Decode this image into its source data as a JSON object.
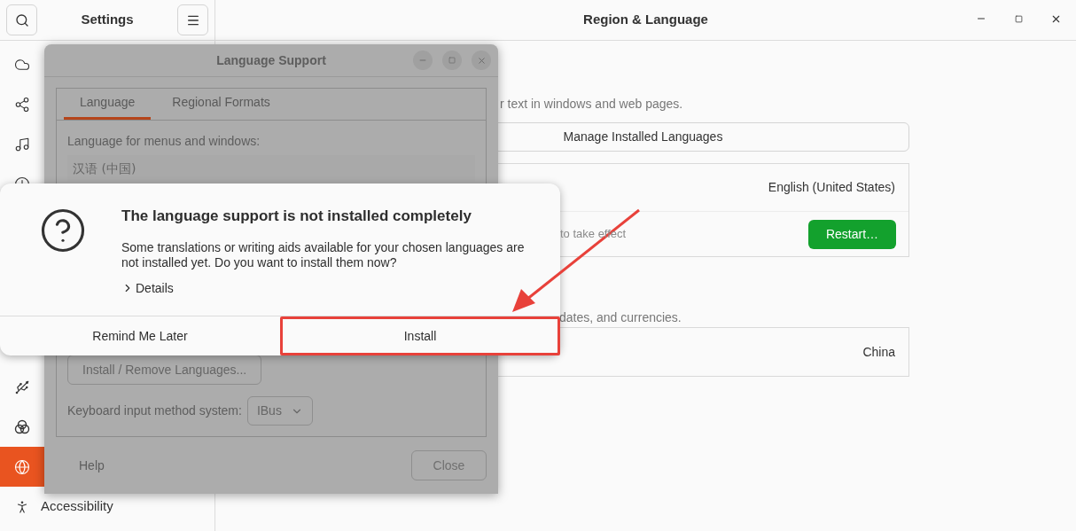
{
  "settings_window": {
    "sidebar_title": "Settings",
    "page_title": "Region & Language",
    "sidebar": {
      "items_top": [
        {
          "kind": "cloud",
          "selected": false
        },
        {
          "kind": "share",
          "selected": false
        },
        {
          "kind": "music",
          "selected": false
        },
        {
          "kind": "clock",
          "selected": false
        }
      ],
      "items_bottom": [
        {
          "kind": "usb",
          "selected": false
        },
        {
          "kind": "color",
          "selected": false
        },
        {
          "kind": "globe",
          "selected": true
        },
        {
          "kind": "accessibility",
          "label": "Accessibility",
          "selected": false
        }
      ]
    },
    "main": {
      "language_hint": "r text in windows and web pages.",
      "manage_button": "Manage Installed Languages",
      "language_card": {
        "value": "English (United States)",
        "note": "to take effect",
        "restart_button": "Restart…"
      },
      "formats_hint": "dates, and currencies.",
      "formats_card": {
        "value": "China"
      }
    }
  },
  "language_support": {
    "title": "Language Support",
    "tabs": [
      {
        "label": "Language",
        "selected": true
      },
      {
        "label": "Regional Formats",
        "selected": false
      }
    ],
    "menus_label": "Language for menus and windows:",
    "languages": [
      "汉语 (中国)"
    ],
    "install_remove_button": "Install / Remove Languages...",
    "input_method_label": "Keyboard input method system:",
    "input_method_value": "IBus",
    "help_button": "Help",
    "close_button": "Close"
  },
  "dialog": {
    "title": "The language support is not installed completely",
    "message": "Some translations or writing aids available for your chosen languages are not installed yet. Do you want to install them now?",
    "details": "Details",
    "buttons": [
      {
        "label": "Remind Me Later",
        "highlighted": false
      },
      {
        "label": "Install",
        "highlighted": true
      }
    ]
  }
}
